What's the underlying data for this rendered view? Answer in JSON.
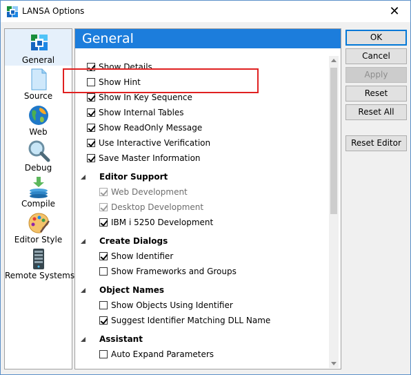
{
  "window": {
    "title": "LANSA Options"
  },
  "icons": {
    "app": "lansa-app-icon",
    "close": "close-icon"
  },
  "nav": [
    {
      "label": "General",
      "icon": "general-icon"
    },
    {
      "label": "Source",
      "icon": "document-icon"
    },
    {
      "label": "Web",
      "icon": "globe-icon"
    },
    {
      "label": "Debug",
      "icon": "magnifier-icon"
    },
    {
      "label": "Compile",
      "icon": "compile-stack-icon"
    },
    {
      "label": "Editor Style",
      "icon": "palette-icon"
    },
    {
      "label": "Remote Systems",
      "icon": "server-icon"
    }
  ],
  "content": {
    "header": "General",
    "general_options": [
      {
        "label": "Show Details",
        "checked": true
      },
      {
        "label": "Show Hint",
        "checked": false
      },
      {
        "label": "Show In Key Sequence",
        "checked": true
      },
      {
        "label": "Show Internal Tables",
        "checked": true
      },
      {
        "label": "Show ReadOnly Message",
        "checked": true
      },
      {
        "label": "Use Interactive Verification",
        "checked": true
      },
      {
        "label": "Save Master Information",
        "checked": true
      }
    ],
    "sections": [
      {
        "title": "Editor Support",
        "options": [
          {
            "label": "Web Development",
            "checked": true,
            "disabled": true
          },
          {
            "label": "Desktop Development",
            "checked": true,
            "disabled": true
          },
          {
            "label": "IBM i 5250 Development",
            "checked": true,
            "disabled": false
          }
        ]
      },
      {
        "title": "Create Dialogs",
        "options": [
          {
            "label": "Show Identifier",
            "checked": true
          },
          {
            "label": "Show Frameworks and Groups",
            "checked": false
          }
        ]
      },
      {
        "title": "Object Names",
        "options": [
          {
            "label": "Show Objects Using Identifier",
            "checked": false
          },
          {
            "label": "Suggest Identifier Matching DLL Name",
            "checked": true
          }
        ]
      },
      {
        "title": "Assistant",
        "options": [
          {
            "label": "Auto Expand Parameters",
            "checked": false
          }
        ]
      }
    ]
  },
  "buttons": {
    "ok": "OK",
    "cancel": "Cancel",
    "apply": "Apply",
    "reset": "Reset",
    "reset_all": "Reset All",
    "reset_editor": "Reset Editor"
  },
  "colors": {
    "header": "#1c7ddc",
    "highlight": "#e02020"
  }
}
